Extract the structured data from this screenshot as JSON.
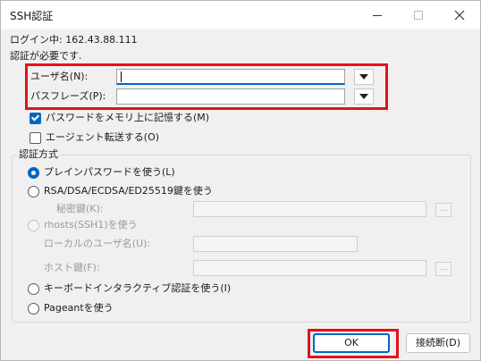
{
  "window": {
    "title": "SSH認証"
  },
  "login": {
    "text": "ログイン中: 162.43.88.111"
  },
  "auth_required": {
    "text": "認証が必要です."
  },
  "username": {
    "label": "ユーザ名(N):",
    "value": ""
  },
  "passphrase": {
    "label": "パスフレーズ(P):",
    "value": ""
  },
  "remember": {
    "label": "パスワードをメモリ上に記憶する(M)",
    "checked": true
  },
  "agent": {
    "label": "エージェント転送する(O)",
    "checked": false
  },
  "method": {
    "label": "認証方式",
    "plain": "プレインパスワードを使う(L)",
    "rsa": "RSA/DSA/ECDSA/ED25519鍵を使う",
    "private_key_label": "秘密鍵(K):",
    "rhosts": "rhosts(SSH1)を使う",
    "local_user_label": "ローカルのユーザ名(U):",
    "host_key_label": "ホスト鍵(F):",
    "keyboard": "キーボードインタラクティブ認証を使う(I)",
    "pageant": "Pageantを使う",
    "browse": "..."
  },
  "buttons": {
    "ok": "OK",
    "disconnect": "接続断(D)"
  },
  "colors": {
    "accent": "#0067c0",
    "highlight": "#e8101a"
  }
}
